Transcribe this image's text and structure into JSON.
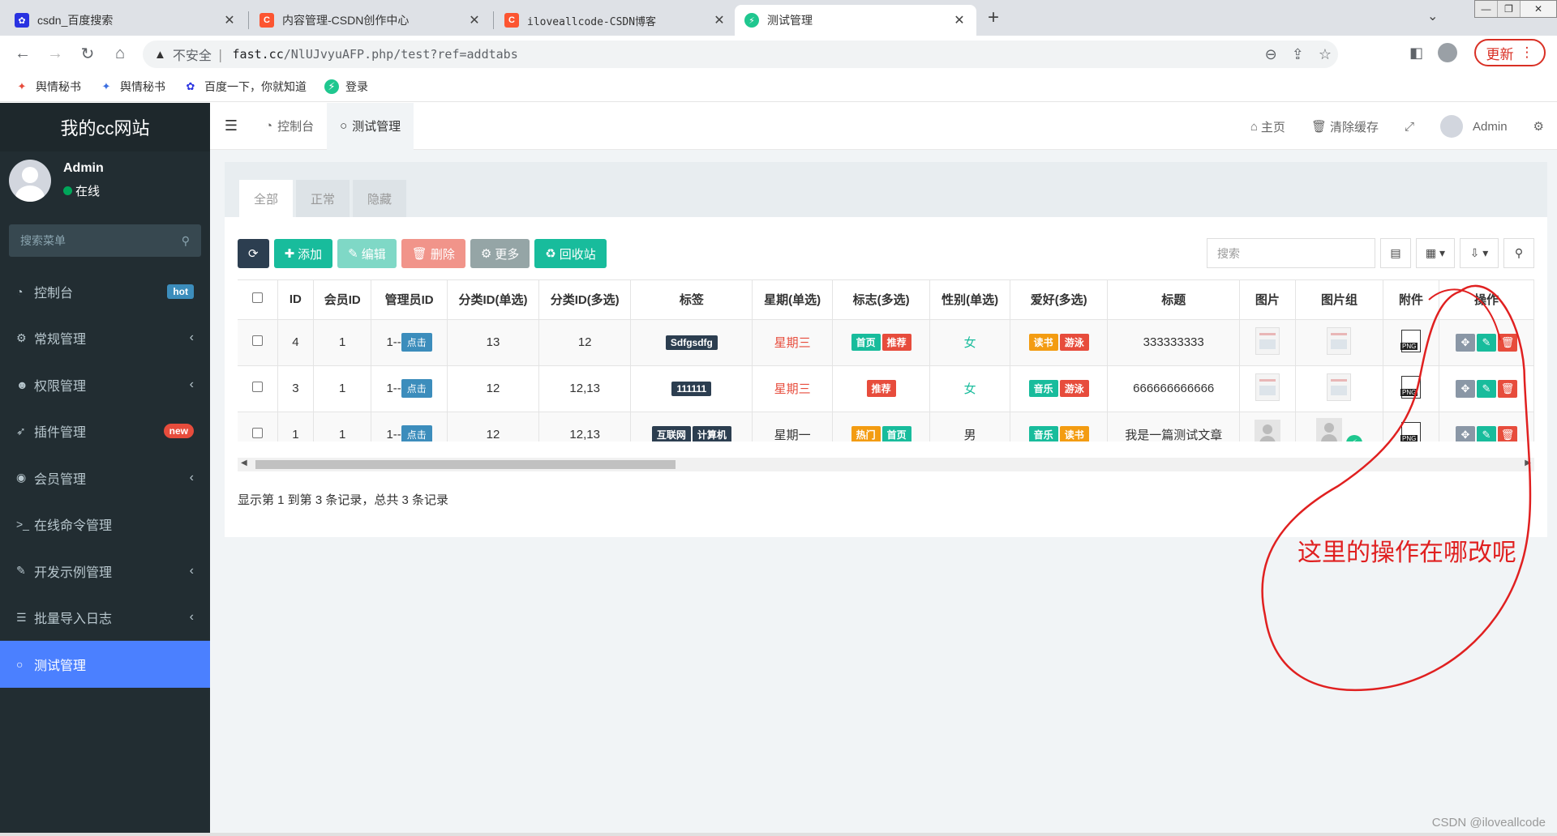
{
  "browser": {
    "tabs": [
      {
        "title": "csdn_百度搜索",
        "favicon": "baidu-paw-icon",
        "color": "#2932e1"
      },
      {
        "title": "内容管理-CSDN创作中心",
        "favicon": "csdn-c-icon",
        "color": "#fc5531"
      },
      {
        "title": "iloveallcode-CSDN博客",
        "favicon": "csdn-c-icon",
        "color": "#fc5531"
      },
      {
        "title": "测试管理",
        "favicon": "bolt-icon",
        "color": "#1fc78f",
        "active": true
      }
    ],
    "new_tab": "+",
    "address": {
      "insecure_label": "不安全",
      "host": "fast.cc",
      "path": "/NlUJvyuAFP.php/test?ref=addtabs"
    },
    "update_label": "更新",
    "bookmarks": [
      {
        "label": "舆情秘书",
        "icon": "yuqing-icon"
      },
      {
        "label": "舆情秘书",
        "icon": "yuqing-icon"
      },
      {
        "label": "百度一下，你就知道",
        "icon": "baidu-paw-icon"
      },
      {
        "label": "登录",
        "icon": "bolt-icon"
      }
    ]
  },
  "app": {
    "logo": "我的cc网站",
    "user": {
      "name": "Admin",
      "status": "在线"
    },
    "search_placeholder": "搜索菜单",
    "menu": [
      {
        "label": "控制台",
        "icon": "dashboard-icon",
        "badge": "hot",
        "badge_color": "#3c8dbc"
      },
      {
        "label": "常规管理",
        "icon": "cogs-icon",
        "caret": "‹"
      },
      {
        "label": "权限管理",
        "icon": "group-icon",
        "caret": "‹"
      },
      {
        "label": "插件管理",
        "icon": "rocket-icon",
        "badge": "new",
        "badge_color": "#e74c3c"
      },
      {
        "label": "会员管理",
        "icon": "user-circle-icon",
        "caret": "‹"
      },
      {
        "label": "在线命令管理",
        "icon": "terminal-icon"
      },
      {
        "label": "开发示例管理",
        "icon": "magic-icon",
        "caret": "‹"
      },
      {
        "label": "批量导入日志",
        "icon": "list-icon",
        "caret": "‹"
      },
      {
        "label": "测试管理",
        "icon": "circle-o-icon",
        "active": true
      }
    ],
    "topnav": {
      "tabs": [
        {
          "label": "控制台",
          "icon": "dashboard-icon"
        },
        {
          "label": "测试管理",
          "icon": "circle-o-icon",
          "active": true
        }
      ],
      "home": "主页",
      "clear_cache": "清除缓存",
      "admin": "Admin"
    },
    "filter_tabs": [
      "全部",
      "正常",
      "隐藏"
    ],
    "toolbar": {
      "add": "添加",
      "edit": "编辑",
      "delete": "删除",
      "more": "更多",
      "recycle": "回收站",
      "search_placeholder": "搜索"
    },
    "table": {
      "headers": [
        "",
        "ID",
        "会员ID",
        "管理员ID",
        "分类ID(单选)",
        "分类ID(多选)",
        "标签",
        "星期(单选)",
        "标志(多选)",
        "性别(单选)",
        "爱好(多选)",
        "标题",
        "图片",
        "图片组",
        "附件",
        "操作"
      ],
      "rows": [
        {
          "id": "4",
          "member_id": "1",
          "admin_id": "1--",
          "admin_btn": "点击",
          "cat_single": "13",
          "cat_multi": "12",
          "tags": [
            "Sdfgsdfg"
          ],
          "weekday": "星期三",
          "weekday_red": true,
          "flags": [
            {
              "t": "首页",
              "c": "#18bc9c"
            },
            {
              "t": "推荐",
              "c": "#e74c3c"
            }
          ],
          "gender": "女",
          "gender_teal": true,
          "hobbies": [
            {
              "t": "读书",
              "c": "#f39c12"
            },
            {
              "t": "游泳",
              "c": "#e74c3c"
            }
          ],
          "title": "333333333",
          "images": "thumb",
          "image_group": "thumb",
          "attachment": "PNG"
        },
        {
          "id": "3",
          "member_id": "1",
          "admin_id": "1--",
          "admin_btn": "点击",
          "cat_single": "12",
          "cat_multi": "12,13",
          "tags": [
            "111111"
          ],
          "weekday": "星期三",
          "weekday_red": true,
          "flags": [
            {
              "t": "推荐",
              "c": "#e74c3c"
            }
          ],
          "gender": "女",
          "gender_teal": true,
          "hobbies": [
            {
              "t": "音乐",
              "c": "#18bc9c"
            },
            {
              "t": "游泳",
              "c": "#e74c3c"
            }
          ],
          "title": "666666666666",
          "images": "thumb",
          "image_group": "thumb",
          "attachment": "PNG"
        },
        {
          "id": "1",
          "member_id": "1",
          "admin_id": "1--",
          "admin_btn": "点击",
          "cat_single": "12",
          "cat_multi": "12,13",
          "tags": [
            "互联网",
            "计算机"
          ],
          "weekday": "星期一",
          "weekday_red": false,
          "flags": [
            {
              "t": "热门",
              "c": "#f39c12"
            },
            {
              "t": "首页",
              "c": "#18bc9c"
            }
          ],
          "gender": "男",
          "gender_teal": false,
          "hobbies": [
            {
              "t": "音乐",
              "c": "#18bc9c"
            },
            {
              "t": "读书",
              "c": "#f39c12"
            }
          ],
          "title": "我是一篇测试文章",
          "images": "placeholder",
          "image_group": "placeholder+bolt",
          "attachment": "PNG"
        }
      ]
    },
    "pager_info": "显示第 1 到第 3 条记录，总共 3 条记录"
  },
  "annotation": {
    "text": "这里的操作在哪改呢",
    "color": "#e02020"
  },
  "watermark": "CSDN @iloveallcode",
  "colors": {
    "sidebar": "#222d32",
    "sidebar_active": "#4b80ff",
    "btn_refresh": "#2c3e50",
    "btn_add": "#18bc9c",
    "btn_edit": "#7fd8c6",
    "btn_delete": "#f1948a",
    "btn_more": "#95a5a6",
    "btn_recycle": "#18bc9c"
  }
}
